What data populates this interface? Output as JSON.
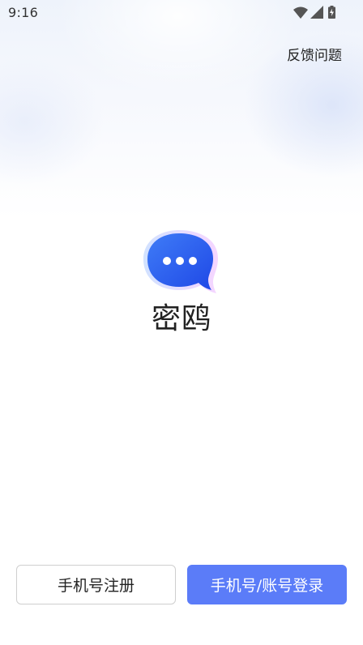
{
  "status_bar": {
    "time": "9:16",
    "icons": [
      "wifi-icon",
      "cellular-signal-icon",
      "battery-charging-icon"
    ]
  },
  "header": {
    "feedback_label": "反馈问题"
  },
  "app": {
    "name": "密鸥",
    "logo_icon": "chat-bubble-icon",
    "logo_color": "#2f5cf0"
  },
  "actions": {
    "register_label": "手机号注册",
    "login_label": "手机号/账号登录",
    "login_color": "#5b7cf8"
  }
}
